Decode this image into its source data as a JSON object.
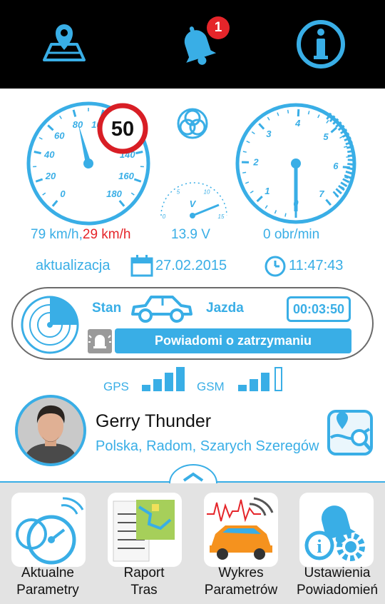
{
  "header": {
    "map_icon": "map-pin-icon",
    "notifications_icon": "bell-icon",
    "notifications_count": "1",
    "info_icon": "info-icon"
  },
  "gauges": {
    "speed_limit": "50",
    "speed_ticks": [
      "0",
      "20",
      "40",
      "60",
      "80",
      "100",
      "120",
      "140",
      "160",
      "180"
    ],
    "rpm_ticks": [
      "0",
      "1",
      "2",
      "3",
      "4",
      "5",
      "6",
      "7"
    ],
    "voltage_ticks": [
      "0",
      "5",
      "10",
      "15"
    ],
    "voltage_unit": "V",
    "speed_reading": "79 km/h,",
    "speed_limit_reading": "29 km/h",
    "voltage_reading": "13.9 V",
    "rpm_reading": "0 obr/min"
  },
  "update": {
    "label": "aktualizacja",
    "date": "27.02.2015",
    "time": "11:47:43"
  },
  "status": {
    "state_label": "Stan",
    "state_value": "Jazda",
    "timer": "00:03:50",
    "notify_button": "Powiadomi o zatrzymaniu"
  },
  "signal": {
    "gps_label": "GPS",
    "gsm_label": "GSM"
  },
  "user": {
    "name": "Gerry Thunder",
    "address": "Polska, Radom, Szarych Szeregów"
  },
  "bottom_nav": [
    {
      "label_line1": "Aktualne",
      "label_line2": "Parametry"
    },
    {
      "label_line1": "Raport",
      "label_line2": "Tras"
    },
    {
      "label_line1": "Wykres",
      "label_line2": "Parametrów"
    },
    {
      "label_line1": "Ustawienia",
      "label_line2": "Powiadomień"
    }
  ],
  "colors": {
    "accent": "#39aee6",
    "alert": "#e5252a",
    "header_bg": "#000000",
    "nav_bg": "#e3e3e3"
  }
}
